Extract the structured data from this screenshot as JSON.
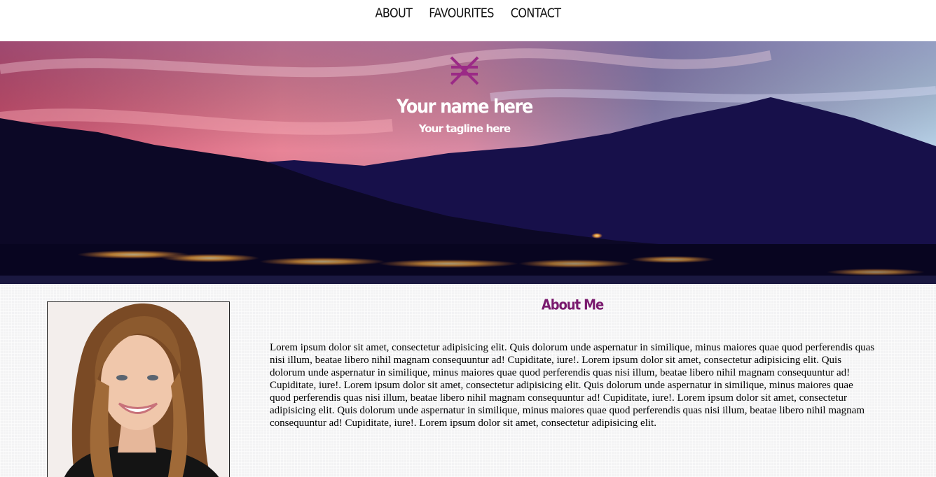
{
  "nav": {
    "items": [
      {
        "label": "ABOUT"
      },
      {
        "label": "FAVOURITES"
      },
      {
        "label": "CONTACT"
      }
    ]
  },
  "hero": {
    "logo_icon": "crosshatch-logo-icon",
    "name": "Your name here",
    "tagline": "Your tagline here"
  },
  "about": {
    "title": "About Me",
    "body": "Lorem ipsum dolor sit amet, consectetur adipisicing elit. Quis dolorum unde aspernatur in similique, minus maiores quae quod perferendis quas nisi illum, beatae libero nihil magnam consequuntur ad! Cupiditate, iure!. Lorem ipsum dolor sit amet, consectetur adipisicing elit. Quis dolorum unde aspernatur in similique, minus maiores quae quod perferendis quas nisi illum, beatae libero nihil magnam consequuntur ad! Cupiditate, iure!. Lorem ipsum dolor sit amet, consectetur adipisicing elit. Quis dolorum unde aspernatur in similique, minus maiores quae quod perferendis quas nisi illum, beatae libero nihil magnam consequuntur ad! Cupiditate, iure!. Lorem ipsum dolor sit amet, consectetur adipisicing elit. Quis dolorum unde aspernatur in similique, minus maiores quae quod perferendis quas nisi illum, beatae libero nihil magnam consequuntur ad! Cupiditate, iure!. Lorem ipsum dolor sit amet, consectetur adipisicing elit."
  },
  "colors": {
    "accent": "#7a1a6e",
    "logo": "#9b2a86",
    "nav_text": "#111111"
  }
}
